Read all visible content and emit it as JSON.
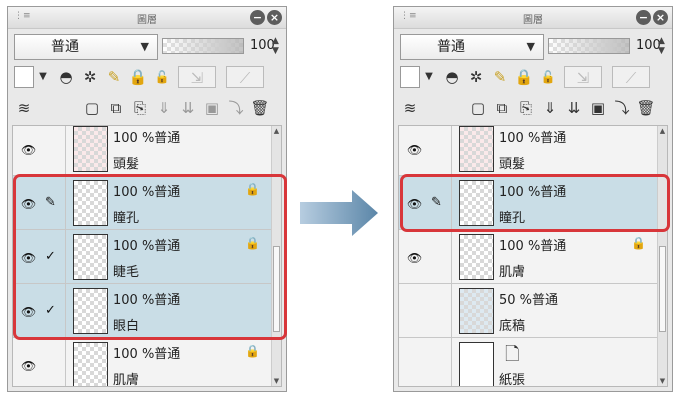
{
  "panels": [
    {
      "title": "圖層",
      "blend_mode": "普通",
      "opacity": "100",
      "layers": [
        {
          "info": "100 %普通",
          "name": "頭髮",
          "mark": "",
          "locked": false,
          "selected": false
        },
        {
          "info": "100 %普通",
          "name": "瞳孔",
          "mark": "✎",
          "locked": true,
          "selected": true
        },
        {
          "info": "100 %普通",
          "name": "睫毛",
          "mark": "✓",
          "locked": true,
          "selected": true
        },
        {
          "info": "100 %普通",
          "name": "眼白",
          "mark": "✓",
          "locked": false,
          "selected": true
        },
        {
          "info": "100 %普通",
          "name": "肌膚",
          "mark": "",
          "locked": true,
          "selected": false
        }
      ]
    },
    {
      "title": "圖層",
      "blend_mode": "普通",
      "opacity": "100",
      "layers": [
        {
          "info": "100 %普通",
          "name": "頭髮",
          "mark": "",
          "locked": false,
          "selected": false
        },
        {
          "info": "100 %普通",
          "name": "瞳孔",
          "mark": "✎",
          "locked": false,
          "selected": true
        },
        {
          "info": "100 %普通",
          "name": "肌膚",
          "mark": "",
          "locked": true,
          "selected": false
        },
        {
          "info": "50 %普通",
          "name": "底稿",
          "mark": "",
          "locked": false,
          "selected": false
        },
        {
          "info": "",
          "name": "紙張",
          "mark": "",
          "locked": false,
          "selected": false
        }
      ]
    }
  ],
  "icons": {
    "eye": "visibility-eye-icon",
    "lock": "lock-icon",
    "paper": "paper-icon"
  },
  "colors": {
    "highlight": "#d8363a",
    "selected_row": "#c9dde6",
    "arrow": "#5b86a8"
  }
}
